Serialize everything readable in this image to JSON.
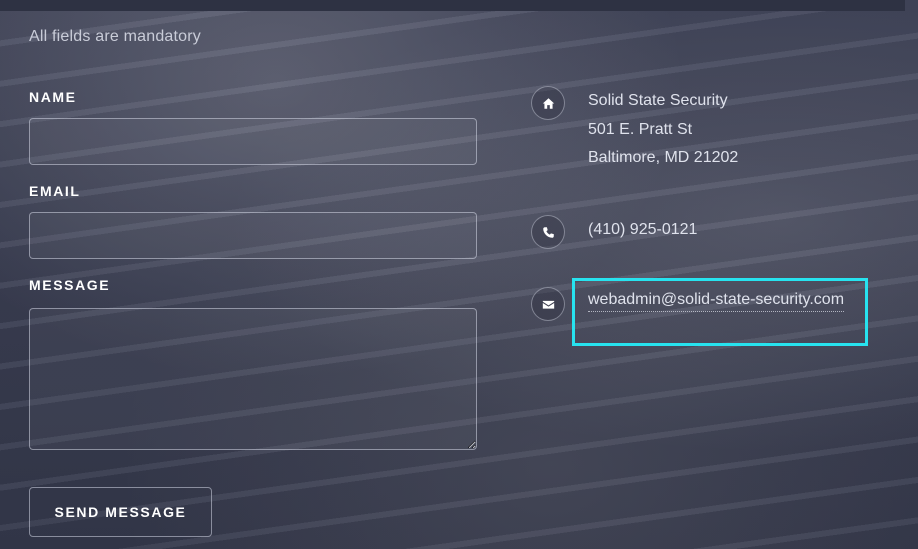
{
  "form": {
    "note": "All fields are mandatory",
    "name_label": "NAME",
    "name_value": "",
    "email_label": "EMAIL",
    "email_value": "",
    "message_label": "MESSAGE",
    "message_value": "",
    "submit_label": "SEND MESSAGE"
  },
  "contact": {
    "address_line1": "Solid State Security",
    "address_line2": "501 E. Pratt St",
    "address_line3": "Baltimore, MD 21202",
    "phone": "(410) 925-0121",
    "email": "webadmin@solid-state-security.com"
  },
  "icons": {
    "address": "home-icon",
    "phone": "phone-icon",
    "email": "envelope-icon"
  },
  "colors": {
    "highlight": "#27e3ef"
  }
}
